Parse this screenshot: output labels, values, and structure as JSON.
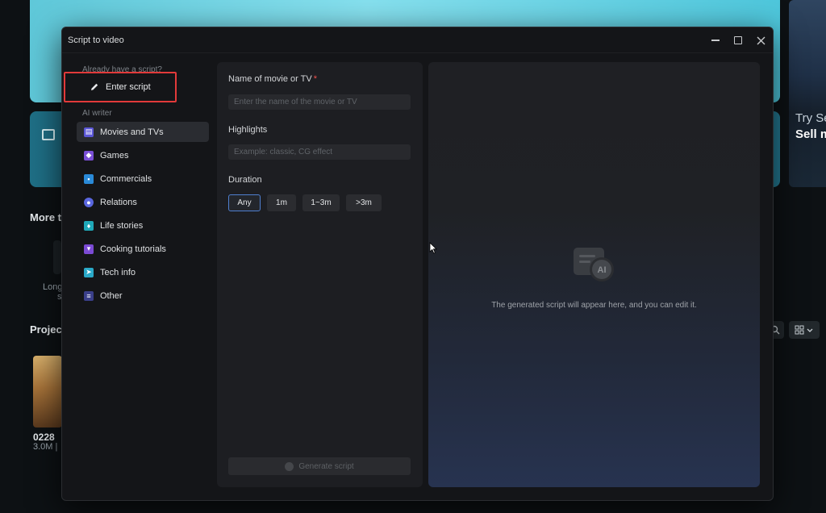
{
  "background": {
    "right_thumb_try": "Try Se",
    "right_thumb_sell": "Sell m",
    "more_heading": "More t",
    "long_label": "Long",
    "long_label2": "s",
    "projects_heading": "Projec",
    "project_name": "0228",
    "project_meta": "3.0M |"
  },
  "dialog": {
    "title": "Script to video",
    "window_controls": [
      "minimize",
      "maximize",
      "close"
    ]
  },
  "sidebar": {
    "already_caption": "Already have a script?",
    "enter_script_label": "Enter script",
    "ai_writer_caption": "AI writer",
    "items": [
      {
        "label": "Movies and TVs",
        "icon": "film-icon",
        "color": "#5b57d6",
        "active": true
      },
      {
        "label": "Games",
        "icon": "gamepad-icon",
        "color": "#7a4fd6",
        "active": false
      },
      {
        "label": "Commercials",
        "icon": "tv-icon",
        "color": "#2a8ad8",
        "active": false
      },
      {
        "label": "Relations",
        "icon": "people-icon",
        "color": "#5a67e0",
        "active": false
      },
      {
        "label": "Life stories",
        "icon": "life-icon",
        "color": "#1fa8b8",
        "active": false
      },
      {
        "label": "Cooking tutorials",
        "icon": "wine-icon",
        "color": "#7b4ad4",
        "active": false
      },
      {
        "label": "Tech info",
        "icon": "rocket-icon",
        "color": "#2aa9c8",
        "active": false
      },
      {
        "label": "Other",
        "icon": "other-icon",
        "color": "#3a3f8a",
        "active": false
      }
    ]
  },
  "form": {
    "name_label": "Name of movie or TV",
    "name_required_mark": "*",
    "name_placeholder": "Enter the name of the movie or TV",
    "highlights_label": "Highlights",
    "highlights_placeholder": "Example: classic, CG effect",
    "duration_label": "Duration",
    "durations": [
      "Any",
      "1m",
      "1~3m",
      ">3m"
    ],
    "selected_duration": "Any",
    "generate_label": "Generate script"
  },
  "preview": {
    "message": "The generated script will appear here, and you can edit it.",
    "badge_text": "AI"
  },
  "colors": {
    "accent_highlight": "#e23a3a",
    "selected_border": "#4f7fd0",
    "required": "#f0524e"
  }
}
